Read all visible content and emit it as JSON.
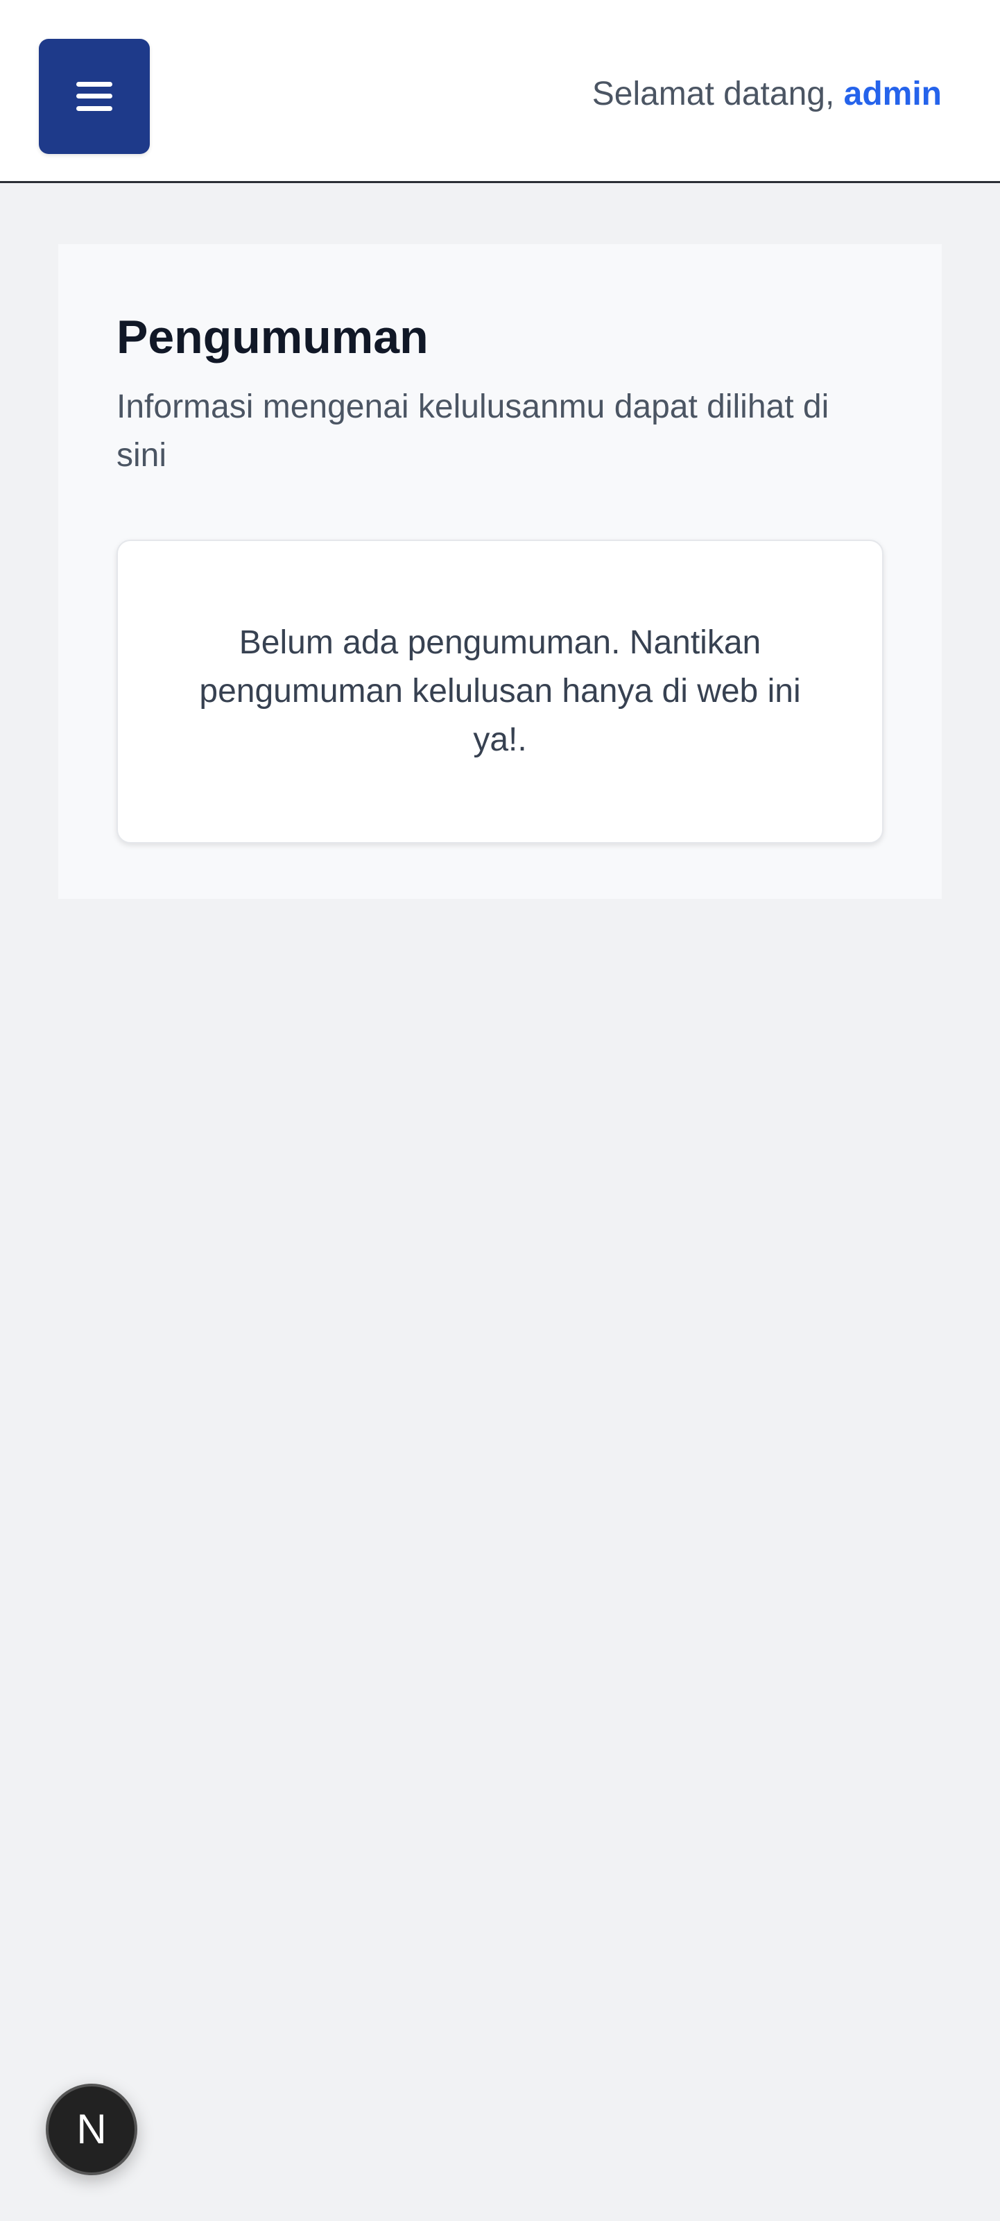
{
  "header": {
    "menu_icon": "hamburger-menu-icon",
    "welcome_prefix": "Selamat datang, ",
    "username": "admin",
    "menu_button_color": "#1e3a8a",
    "username_color": "#2563eb"
  },
  "announcements": {
    "title": "Pengumuman",
    "subtitle": "Informasi mengenai kelulusanmu dapat dilihat di sini",
    "empty_message": "Belum ada pengumuman. Nantikan pengumuman kelulusan hanya di web ini ya!."
  },
  "floating_badge": {
    "label": "N"
  }
}
